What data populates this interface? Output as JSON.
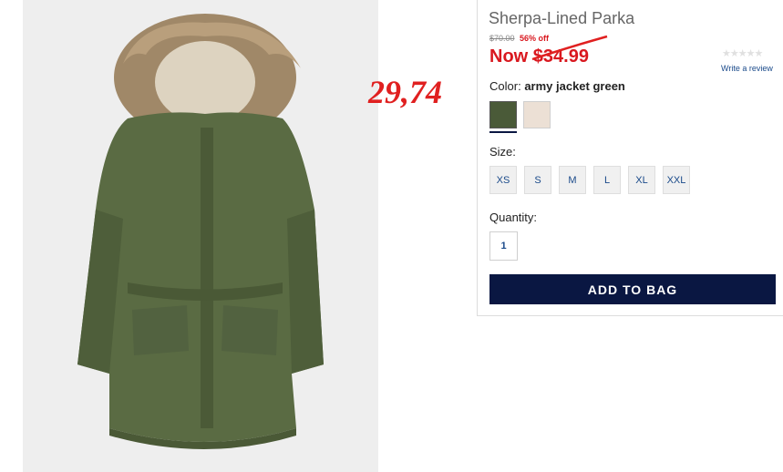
{
  "product": {
    "title": "Sherpa-Lined Parka",
    "old_price": "$70.00",
    "percent_off": "56% off",
    "now_price": "Now $34.99",
    "handwritten_note": "29,74"
  },
  "reviews": {
    "stars": "★★★★★",
    "link_label": "Write a review"
  },
  "color": {
    "label": "Color:",
    "selected": "army jacket green",
    "swatches": [
      {
        "name": "army jacket green",
        "hex": "#4a5a38"
      },
      {
        "name": "cream",
        "hex": "#ece0d5"
      }
    ]
  },
  "size": {
    "label": "Size:",
    "options": [
      "XS",
      "S",
      "M",
      "L",
      "XL",
      "XXL"
    ]
  },
  "quantity": {
    "label": "Quantity:",
    "value": "1"
  },
  "actions": {
    "add_to_bag": "ADD TO BAG"
  },
  "colors": {
    "sale_red": "#d9181f",
    "navy": "#0a1742",
    "link_blue": "#1a4a8a"
  }
}
